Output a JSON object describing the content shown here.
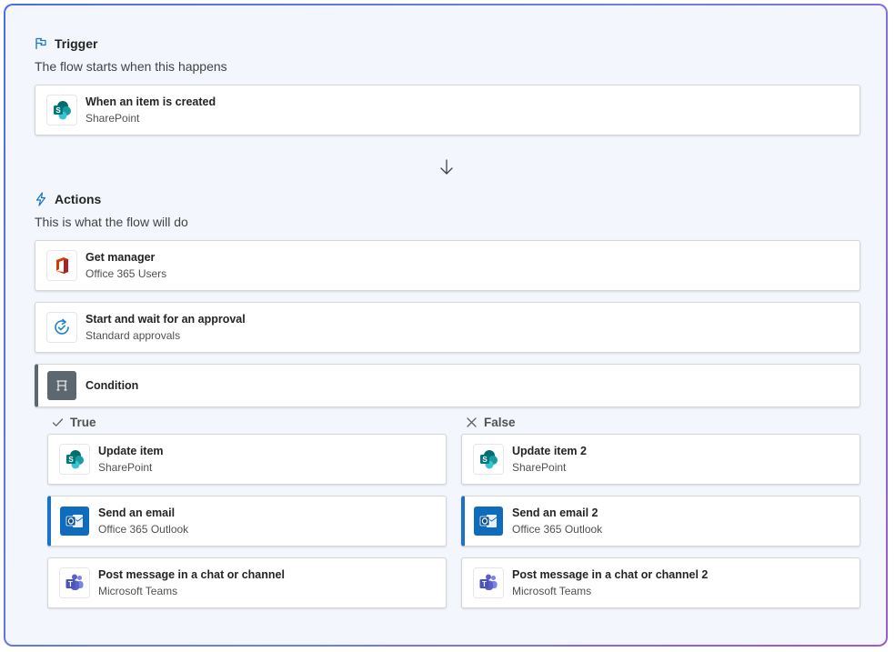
{
  "trigger": {
    "heading": "Trigger",
    "subtitle": "The flow starts when this happens",
    "card": {
      "title": "When an item is created",
      "subtitle": "SharePoint",
      "icon": "sharepoint-icon"
    }
  },
  "actions": {
    "heading": "Actions",
    "subtitle": "This is what the flow will do",
    "cards": [
      {
        "title": "Get manager",
        "subtitle": "Office 365 Users",
        "icon": "office365-icon"
      },
      {
        "title": "Start and wait for an approval",
        "subtitle": "Standard approvals",
        "icon": "approvals-icon"
      },
      {
        "title": "Condition",
        "icon": "condition-icon"
      }
    ]
  },
  "branches": {
    "true": {
      "label": "True",
      "cards": [
        {
          "title": "Update item",
          "subtitle": "SharePoint",
          "icon": "sharepoint-icon"
        },
        {
          "title": "Send an email",
          "subtitle": "Office 365 Outlook",
          "icon": "outlook-icon"
        },
        {
          "title": "Post message in a chat or channel",
          "subtitle": "Microsoft Teams",
          "icon": "teams-icon"
        }
      ]
    },
    "false": {
      "label": "False",
      "cards": [
        {
          "title": "Update item 2",
          "subtitle": "SharePoint",
          "icon": "sharepoint-icon"
        },
        {
          "title": "Send an email 2",
          "subtitle": "Office 365 Outlook",
          "icon": "outlook-icon"
        },
        {
          "title": "Post message in a chat or channel 2",
          "subtitle": "Microsoft Teams",
          "icon": "teams-icon"
        }
      ]
    }
  },
  "colors": {
    "accent": "#1a73c9",
    "sharepoint": "#038387",
    "outlook": "#0f6cbd",
    "teams": "#5b5fc7",
    "office": "#d83b01",
    "condition": "#5c6770"
  }
}
